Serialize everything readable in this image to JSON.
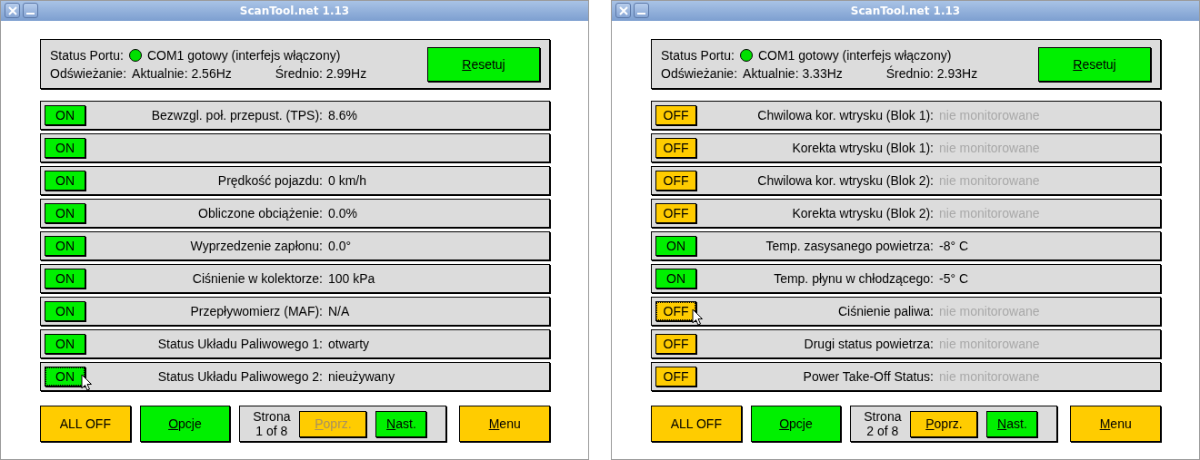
{
  "windows": [
    {
      "title": "ScanTool.net 1.13",
      "status": {
        "port_label": "Status Portu:",
        "port_ok": true,
        "port_text": "COM1 gotowy (interfejs włączony)",
        "refresh_label": "Odświeżanie:",
        "current": "Aktualnie: 2.56Hz",
        "average": "Średnio: 2.99Hz",
        "reset": {
          "mnemonic": "R",
          "rest": "esetuj"
        }
      },
      "rows": [
        {
          "toggle": "ON",
          "on": true,
          "focused": false,
          "label": "Bezwzgl. poł. przepust. (TPS):",
          "value": "8.6%",
          "monitored": true
        },
        {
          "toggle": "ON",
          "on": true,
          "focused": false
        },
        {
          "toggle": "ON",
          "on": true,
          "focused": false,
          "label": "Prędkość pojazdu:",
          "value": "0 km/h",
          "monitored": true
        },
        {
          "toggle": "ON",
          "on": true,
          "focused": false,
          "label": "Obliczone obciążenie:",
          "value": "0.0%",
          "monitored": true
        },
        {
          "toggle": "ON",
          "on": true,
          "focused": false,
          "label": "Wyprzedzenie zapłonu:",
          "value": "0.0°",
          "monitored": true
        },
        {
          "toggle": "ON",
          "on": true,
          "focused": false,
          "label": "Ciśnienie w kolektorze:",
          "value": "100 kPa",
          "monitored": true
        },
        {
          "toggle": "ON",
          "on": true,
          "focused": false,
          "label": "Przepływomierz (MAF):",
          "value": "N/A",
          "monitored": true
        },
        {
          "toggle": "ON",
          "on": true,
          "focused": false,
          "label": "Status Układu Paliwowego 1:",
          "value": "otwarty",
          "monitored": true
        },
        {
          "toggle": "ON",
          "on": true,
          "focused": true,
          "label": "Status Układu Paliwowego 2:",
          "value": "nieużywany",
          "monitored": true
        }
      ],
      "bottom": {
        "all_off": "ALL OFF",
        "options": {
          "mnemonic": "O",
          "rest": "pcje"
        },
        "page_label": "Strona",
        "page": "1 of 8",
        "prev": {
          "mnemonic": "P",
          "rest": "oprz.",
          "disabled": true
        },
        "next": {
          "mnemonic": "N",
          "rest": "ast.",
          "disabled": false
        },
        "menu": {
          "mnemonic": "M",
          "rest": "enu"
        }
      }
    },
    {
      "title": "ScanTool.net 1.13",
      "status": {
        "port_label": "Status Portu:",
        "port_ok": true,
        "port_text": "COM1 gotowy (interfejs włączony)",
        "refresh_label": "Odświeżanie:",
        "current": "Aktualnie: 3.33Hz",
        "average": "Średnio: 2.93Hz",
        "reset": {
          "mnemonic": "R",
          "rest": "esetuj"
        }
      },
      "rows": [
        {
          "toggle": "OFF",
          "on": false,
          "focused": false,
          "label": "Chwilowa kor. wtrysku (Blok 1):",
          "value": "nie monitorowane",
          "monitored": false
        },
        {
          "toggle": "OFF",
          "on": false,
          "focused": false,
          "label": "Korekta wtrysku (Blok 1):",
          "value": "nie monitorowane",
          "monitored": false
        },
        {
          "toggle": "OFF",
          "on": false,
          "focused": false,
          "label": "Chwilowa kor. wtrysku (Blok 2):",
          "value": "nie monitorowane",
          "monitored": false
        },
        {
          "toggle": "OFF",
          "on": false,
          "focused": false,
          "label": "Korekta wtrysku (Blok 2):",
          "value": "nie monitorowane",
          "monitored": false
        },
        {
          "toggle": "ON",
          "on": true,
          "focused": false,
          "label": "Temp. zasysanego powietrza:",
          "value": "-8° C",
          "monitored": true
        },
        {
          "toggle": "ON",
          "on": true,
          "focused": false,
          "label": "Temp. płynu w chłodzącego:",
          "value": "-5° C",
          "monitored": true
        },
        {
          "toggle": "OFF",
          "on": false,
          "focused": true,
          "label": "Ciśnienie paliwa:",
          "value": "nie monitorowane",
          "monitored": false
        },
        {
          "toggle": "OFF",
          "on": false,
          "focused": false,
          "label": "Drugi status powietrza:",
          "value": "nie monitorowane",
          "monitored": false
        },
        {
          "toggle": "OFF",
          "on": false,
          "focused": false,
          "label": "Power Take-Off Status:",
          "value": "nie monitorowane",
          "monitored": false
        }
      ],
      "bottom": {
        "all_off": "ALL OFF",
        "options": {
          "mnemonic": "O",
          "rest": "pcje"
        },
        "page_label": "Strona",
        "page": "2 of 8",
        "prev": {
          "mnemonic": "P",
          "rest": "oprz.",
          "disabled": false
        },
        "next": {
          "mnemonic": "N",
          "rest": "ast.",
          "disabled": false
        },
        "menu": {
          "mnemonic": "M",
          "rest": "enu"
        }
      }
    }
  ]
}
